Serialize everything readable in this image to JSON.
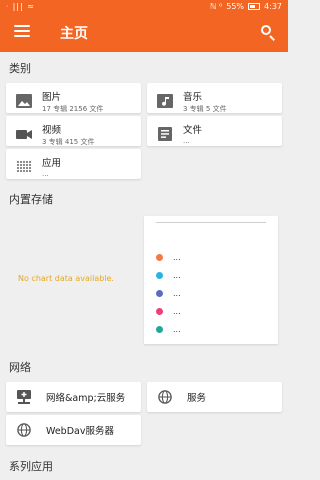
{
  "status_bar": {
    "left": "ᐧ |||  ≈",
    "signal": "ℕ ⁰",
    "battery": "55%",
    "time": "4:37"
  },
  "app_bar": {
    "title": "主页",
    "accent": "#f26522"
  },
  "categories": {
    "title": "类别",
    "items": [
      {
        "name": "图片",
        "sub": "17 专辑 2156 文件",
        "icon": "image-icon"
      },
      {
        "name": "音乐",
        "sub": "3 专辑 5 文件",
        "icon": "music-note-icon"
      },
      {
        "name": "视频",
        "sub": "3 专辑 415 文件",
        "icon": "videocam-icon"
      },
      {
        "name": "文件",
        "sub": "...",
        "icon": "document-icon"
      },
      {
        "name": "应用",
        "sub": "...",
        "icon": "apps-grid-icon"
      }
    ]
  },
  "storage": {
    "title": "内置存储",
    "no_data": "No chart data available.",
    "legend": [
      {
        "label": "...",
        "color": "#f4794a"
      },
      {
        "label": "...",
        "color": "#27b5e0"
      },
      {
        "label": "...",
        "color": "#5c6bc0"
      },
      {
        "label": "...",
        "color": "#ec407a"
      },
      {
        "label": "...",
        "color": "#26a69a"
      }
    ]
  },
  "network": {
    "title": "网络",
    "items": [
      {
        "name": "网络&amp;云服务",
        "icon": "network-computer-icon"
      },
      {
        "name": "服务",
        "icon": "globe-icon"
      },
      {
        "name": "WebDav服务器",
        "icon": "globe-icon"
      }
    ]
  },
  "series_apps": {
    "title": "系列应用"
  }
}
